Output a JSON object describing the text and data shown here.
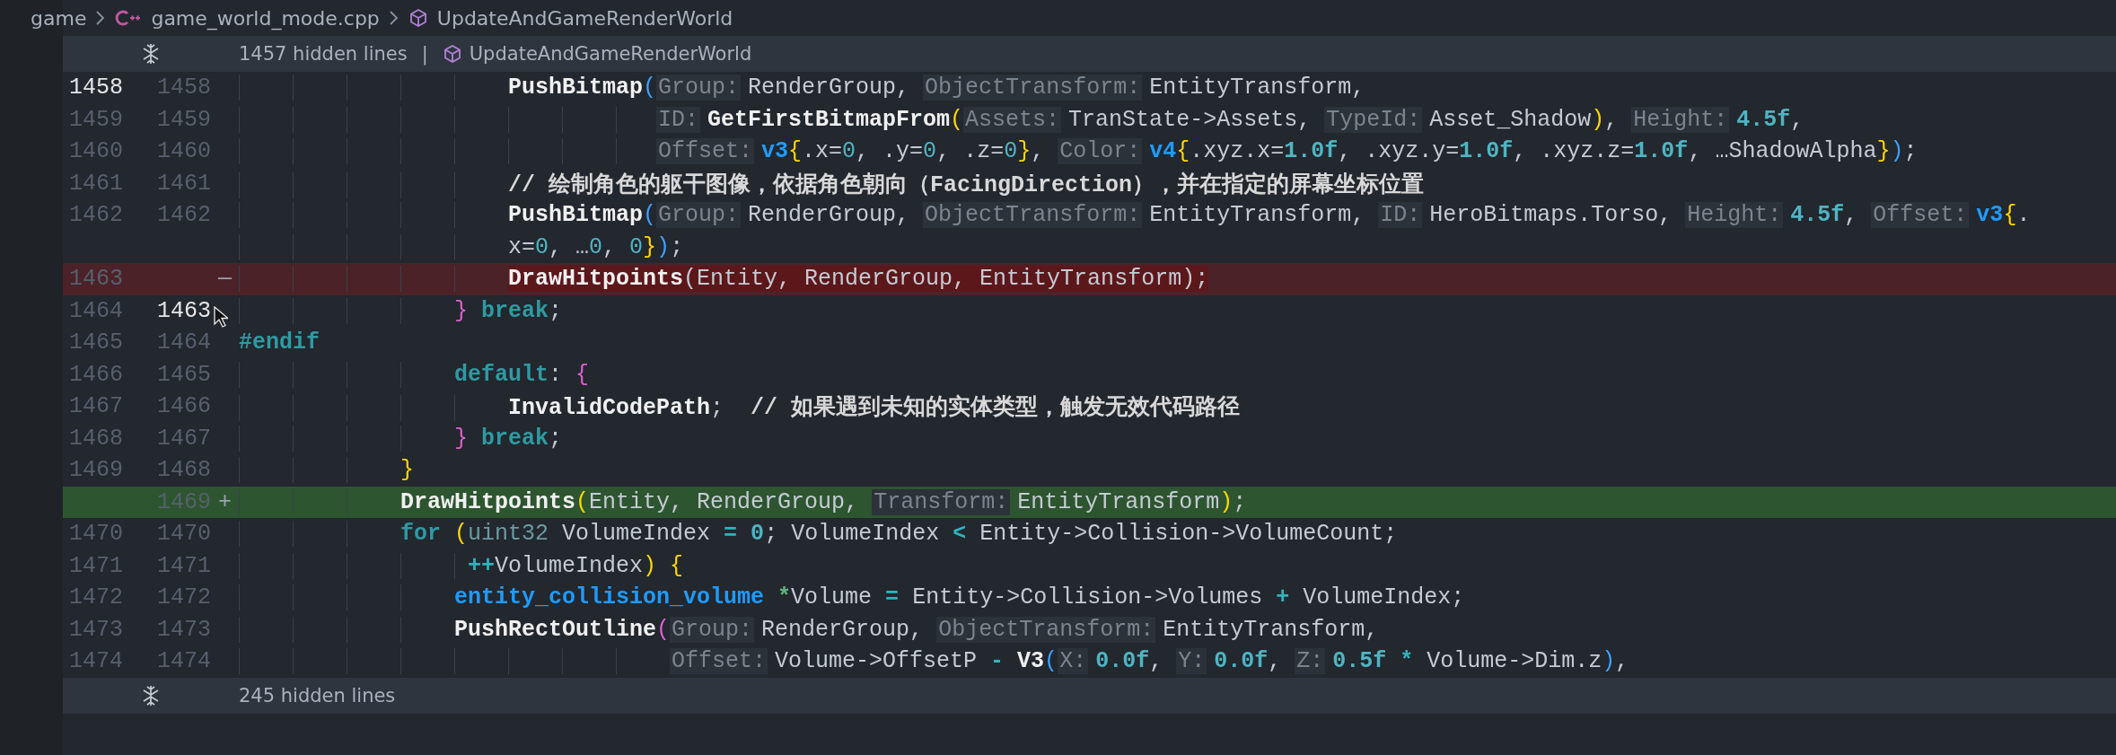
{
  "breadcrumb": [
    {
      "kind": "folder",
      "label": "game"
    },
    {
      "kind": "cpp-file",
      "label": "game_world_mode.cpp"
    },
    {
      "kind": "symbol",
      "label": "UpdateAndGameRenderWorld"
    }
  ],
  "rows": [
    {
      "kind": "fold",
      "label": "1457 hidden lines",
      "separator": "|",
      "scope": "UpdateAndGameRenderWorld"
    },
    {
      "kind": "context",
      "old": "1458",
      "new": "1458",
      "old_active": true,
      "new_active": false,
      "tokens": [
        {
          "text": "                    PushBitmap",
          "kind": "f"
        },
        {
          "text": "(",
          "kind": "b1"
        },
        {
          "text": "Group:",
          "kind": "h"
        },
        {
          "text": "RenderGroup, ",
          "kind": "p"
        },
        {
          "text": "ObjectTransform:",
          "kind": "h"
        },
        {
          "text": "EntityTransform,",
          "kind": "p"
        }
      ]
    },
    {
      "kind": "context",
      "old": "1459",
      "new": "1459",
      "old_active": false,
      "new_active": false,
      "tokens": [
        {
          "text": "                               ID:",
          "kind": "h"
        },
        {
          "text": "GetFirstBitmapFrom",
          "kind": "f"
        },
        {
          "text": "(",
          "kind": "b2"
        },
        {
          "text": "Assets:",
          "kind": "h"
        },
        {
          "text": "TranState->Assets, ",
          "kind": "p"
        },
        {
          "text": "TypeId:",
          "kind": "h"
        },
        {
          "text": "Asset_Shadow",
          "kind": "p"
        },
        {
          "text": ")",
          "kind": "b2"
        },
        {
          "text": ", ",
          "kind": "p"
        },
        {
          "text": "Height:",
          "kind": "h"
        },
        {
          "text": "4.5f",
          "kind": "n"
        },
        {
          "text": ",",
          "kind": "p"
        }
      ]
    },
    {
      "kind": "context",
      "old": "1460",
      "new": "1460",
      "old_active": false,
      "new_active": false,
      "tokens": [
        {
          "text": "                               Offset:",
          "kind": "h"
        },
        {
          "text": "v3",
          "kind": "ty"
        },
        {
          "text": "{",
          "kind": "b2"
        },
        {
          "text": ".x=",
          "kind": "p"
        },
        {
          "text": "0",
          "kind": "n0"
        },
        {
          "text": ", .y=",
          "kind": "p"
        },
        {
          "text": "0",
          "kind": "n0"
        },
        {
          "text": ", .z=",
          "kind": "p"
        },
        {
          "text": "0",
          "kind": "n0"
        },
        {
          "text": "}",
          "kind": "b2"
        },
        {
          "text": ", ",
          "kind": "p"
        },
        {
          "text": "Color:",
          "kind": "h"
        },
        {
          "text": "v4",
          "kind": "ty"
        },
        {
          "text": "{",
          "kind": "b2"
        },
        {
          "text": ".xyz.x=",
          "kind": "p"
        },
        {
          "text": "1.0f",
          "kind": "n"
        },
        {
          "text": ", .xyz.y=",
          "kind": "p"
        },
        {
          "text": "1.0f",
          "kind": "n"
        },
        {
          "text": ", .xyz.z=",
          "kind": "p"
        },
        {
          "text": "1.0f",
          "kind": "n"
        },
        {
          "text": ", …ShadowAlpha",
          "kind": "p"
        },
        {
          "text": "}",
          "kind": "b2"
        },
        {
          "text": ")",
          "kind": "b1"
        },
        {
          "text": ";",
          "kind": "p"
        }
      ]
    },
    {
      "kind": "context",
      "old": "1461",
      "new": "1461",
      "old_active": false,
      "new_active": false,
      "tokens": [
        {
          "text": "                    // 绘制角色的躯干图像，依据角色朝向（FacingDirection），并在指定的屏幕坐标位置",
          "kind": "c"
        }
      ]
    },
    {
      "kind": "context",
      "old": "1462",
      "new": "1462",
      "old_active": false,
      "new_active": false,
      "tokens": [
        {
          "text": "                    PushBitmap",
          "kind": "f"
        },
        {
          "text": "(",
          "kind": "b1"
        },
        {
          "text": "Group:",
          "kind": "h"
        },
        {
          "text": "RenderGroup, ",
          "kind": "p"
        },
        {
          "text": "ObjectTransform:",
          "kind": "h"
        },
        {
          "text": "EntityTransform, ",
          "kind": "p"
        },
        {
          "text": "ID:",
          "kind": "h"
        },
        {
          "text": "HeroBitmaps.Torso, ",
          "kind": "p"
        },
        {
          "text": "Height:",
          "kind": "h"
        },
        {
          "text": "4.5f",
          "kind": "n"
        },
        {
          "text": ", ",
          "kind": "p"
        },
        {
          "text": "Offset:",
          "kind": "h"
        },
        {
          "text": "v3",
          "kind": "ty"
        },
        {
          "text": "{",
          "kind": "b2"
        },
        {
          "text": ".",
          "kind": "p"
        }
      ]
    },
    {
      "kind": "context",
      "tokens": [
        {
          "text": "                    x=",
          "kind": "p"
        },
        {
          "text": "0",
          "kind": "n0"
        },
        {
          "text": ", …",
          "kind": "p"
        },
        {
          "text": "0",
          "kind": "n0"
        },
        {
          "text": ", ",
          "kind": "p"
        },
        {
          "text": "0",
          "kind": "n0"
        },
        {
          "text": "}",
          "kind": "b2"
        },
        {
          "text": ")",
          "kind": "b1"
        },
        {
          "text": ";",
          "kind": "p"
        }
      ]
    },
    {
      "kind": "removed",
      "old": "1463",
      "marker": "—",
      "old_active": false,
      "tokens": [
        {
          "text": "                    DrawHitpoints",
          "kind": "f"
        },
        {
          "text": "(Entity, RenderGroup, EntityTransform);",
          "kind": "p"
        }
      ]
    },
    {
      "kind": "context",
      "old": "1464",
      "new": "1463",
      "old_active": false,
      "new_active": true,
      "tokens": [
        {
          "text": "                }",
          "kind": "b3"
        },
        {
          "text": " break",
          "kind": "kw"
        },
        {
          "text": ";",
          "kind": "p"
        }
      ]
    },
    {
      "kind": "context",
      "old": "1465",
      "new": "1464",
      "old_active": false,
      "new_active": false,
      "tokens": [
        {
          "text": "#endif",
          "kind": "pp"
        }
      ]
    },
    {
      "kind": "context",
      "old": "1466",
      "new": "1465",
      "old_active": false,
      "new_active": false,
      "tokens": [
        {
          "text": "                default",
          "kind": "kw"
        },
        {
          "text": ": ",
          "kind": "p"
        },
        {
          "text": "{",
          "kind": "b3"
        }
      ]
    },
    {
      "kind": "context",
      "old": "1467",
      "new": "1466",
      "old_active": false,
      "new_active": false,
      "tokens": [
        {
          "text": "                    InvalidCodePath",
          "kind": "f"
        },
        {
          "text": ";  ",
          "kind": "p"
        },
        {
          "text": "// 如果遇到未知的实体类型，触发无效代码路径",
          "kind": "c"
        }
      ]
    },
    {
      "kind": "context",
      "old": "1468",
      "new": "1467",
      "old_active": false,
      "new_active": false,
      "tokens": [
        {
          "text": "                }",
          "kind": "b3"
        },
        {
          "text": " break",
          "kind": "kw"
        },
        {
          "text": ";",
          "kind": "p"
        }
      ]
    },
    {
      "kind": "context",
      "old": "1469",
      "new": "1468",
      "old_active": false,
      "new_active": false,
      "tokens": [
        {
          "text": "            }",
          "kind": "b2"
        }
      ]
    },
    {
      "kind": "added",
      "new": "1469",
      "marker": "+",
      "new_active": false,
      "tokens": [
        {
          "text": "            DrawHitpoints",
          "kind": "f"
        },
        {
          "text": "(",
          "kind": "b2"
        },
        {
          "text": "Entity, RenderGroup, ",
          "kind": "p"
        },
        {
          "text": "Transform:",
          "kind": "h"
        },
        {
          "text": "EntityTransform",
          "kind": "p"
        },
        {
          "text": ")",
          "kind": "b2"
        },
        {
          "text": ";",
          "kind": "p"
        }
      ]
    },
    {
      "kind": "context",
      "old": "1470",
      "new": "1470",
      "old_active": false,
      "new_active": false,
      "tokens": [
        {
          "text": "            for",
          "kind": "kw"
        },
        {
          "text": " (",
          "kind": "b2"
        },
        {
          "text": "uint32",
          "kind": "t2"
        },
        {
          "text": " VolumeIndex ",
          "kind": "p"
        },
        {
          "text": "=",
          "kind": "op"
        },
        {
          "text": " 0",
          "kind": "n"
        },
        {
          "text": "; VolumeIndex ",
          "kind": "p"
        },
        {
          "text": "<",
          "kind": "op"
        },
        {
          "text": " Entity->Collision->VolumeCount;",
          "kind": "p"
        }
      ]
    },
    {
      "kind": "context",
      "old": "1471",
      "new": "1471",
      "old_active": false,
      "new_active": false,
      "tokens": [
        {
          "text": "                 ++",
          "kind": "op"
        },
        {
          "text": "VolumeIndex",
          "kind": "p"
        },
        {
          "text": ")",
          "kind": "b2"
        },
        {
          "text": " {",
          "kind": "b2"
        }
      ]
    },
    {
      "kind": "context",
      "old": "1472",
      "new": "1472",
      "old_active": false,
      "new_active": false,
      "tokens": [
        {
          "text": "                entity_collision_volume",
          "kind": "ty"
        },
        {
          "text": " *",
          "kind": "op2"
        },
        {
          "text": "Volume ",
          "kind": "p"
        },
        {
          "text": "=",
          "kind": "op"
        },
        {
          "text": " Entity->Collision->Volumes ",
          "kind": "p"
        },
        {
          "text": "+",
          "kind": "op"
        },
        {
          "text": " VolumeIndex;",
          "kind": "p"
        }
      ]
    },
    {
      "kind": "context",
      "old": "1473",
      "new": "1473",
      "old_active": false,
      "new_active": false,
      "tokens": [
        {
          "text": "                PushRectOutline",
          "kind": "f"
        },
        {
          "text": "(",
          "kind": "b3"
        },
        {
          "text": "Group:",
          "kind": "h"
        },
        {
          "text": "RenderGroup, ",
          "kind": "p"
        },
        {
          "text": "ObjectTransform:",
          "kind": "h"
        },
        {
          "text": "EntityTransform,",
          "kind": "p"
        }
      ]
    },
    {
      "kind": "context",
      "old": "1474",
      "new": "1474",
      "old_active": false,
      "new_active": false,
      "tokens": [
        {
          "text": "                                Offset:",
          "kind": "h"
        },
        {
          "text": "Volume->OffsetP ",
          "kind": "p"
        },
        {
          "text": "-",
          "kind": "op"
        },
        {
          "text": " V3",
          "kind": "f"
        },
        {
          "text": "(",
          "kind": "b1"
        },
        {
          "text": "X:",
          "kind": "h"
        },
        {
          "text": "0.0f",
          "kind": "n"
        },
        {
          "text": ", ",
          "kind": "p"
        },
        {
          "text": "Y:",
          "kind": "h"
        },
        {
          "text": "0.0f",
          "kind": "n"
        },
        {
          "text": ", ",
          "kind": "p"
        },
        {
          "text": "Z:",
          "kind": "h"
        },
        {
          "text": "0.5f",
          "kind": "n"
        },
        {
          "text": " *",
          "kind": "op"
        },
        {
          "text": " Volume->Dim.z",
          "kind": "p"
        },
        {
          "text": ")",
          "kind": "b1"
        },
        {
          "text": ",",
          "kind": "p"
        }
      ]
    },
    {
      "kind": "fold",
      "label": "245 hidden lines"
    }
  ]
}
